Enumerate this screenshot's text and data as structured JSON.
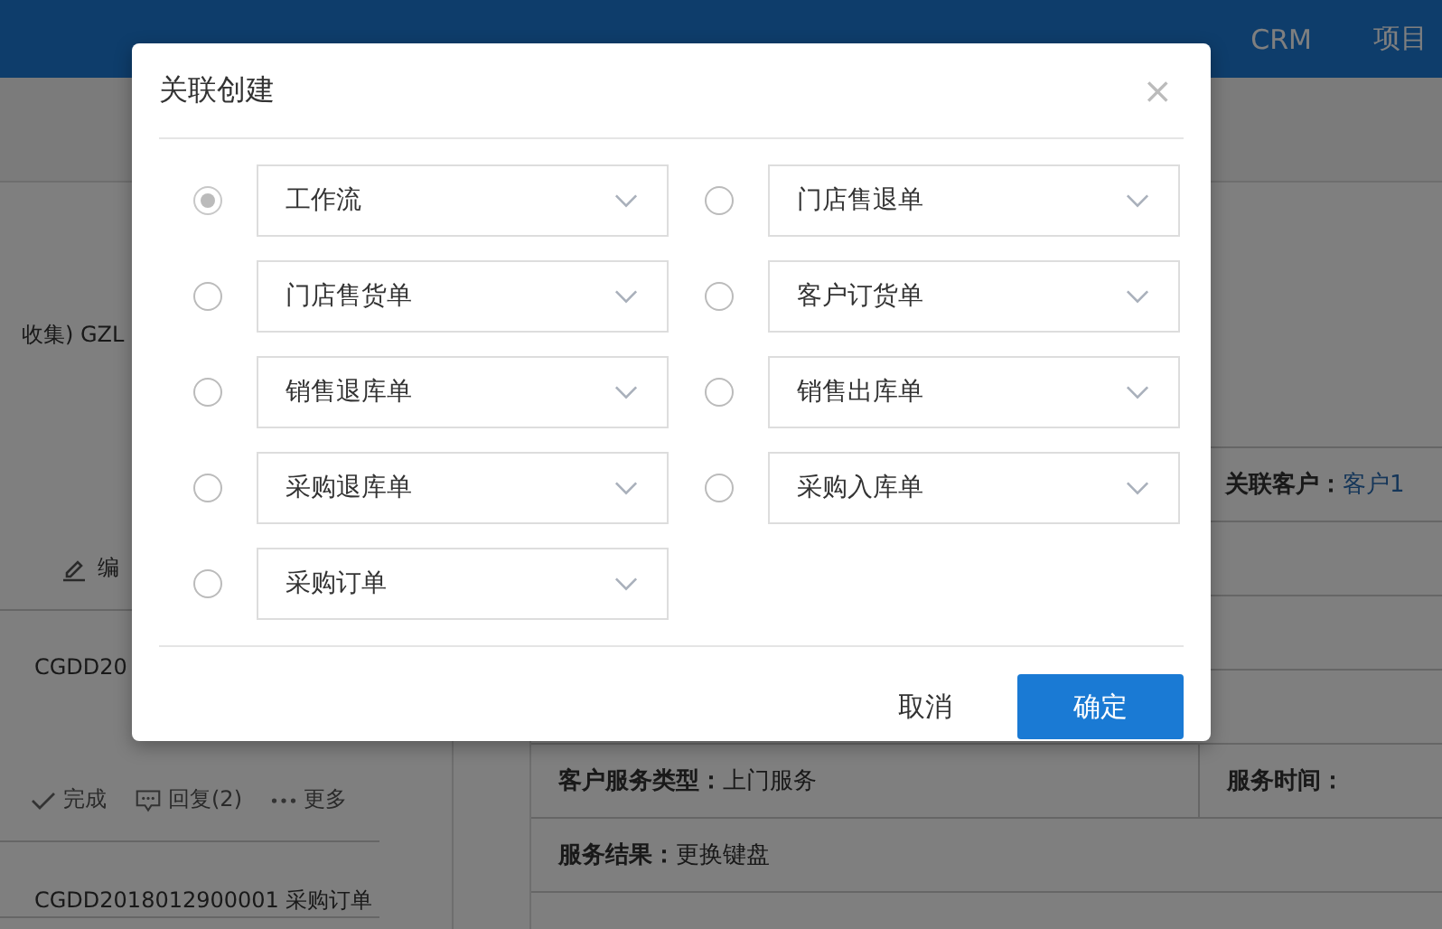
{
  "nav": [
    "CRM",
    "项目"
  ],
  "left_panel": {
    "header_text": "收集)  GZL",
    "actions_top": [
      {
        "kind": "edit",
        "label": "编"
      }
    ],
    "cards": [
      {
        "title": "CGDD20",
        "actions": [
          {
            "kind": "check",
            "label": "完成"
          },
          {
            "kind": "reply",
            "label": "回复(2)"
          },
          {
            "kind": "more",
            "label": "更多"
          }
        ]
      },
      {
        "title": "CGDD2018012900001 采购订单"
      }
    ]
  },
  "detail_rows": [
    {
      "kind": "field",
      "side_label": "关联客户：",
      "side_value": "客户1"
    },
    {
      "kind": "empty"
    },
    {
      "kind": "empty"
    },
    {
      "kind": "empty"
    },
    {
      "kind": "field",
      "label": "客户服务类型：",
      "value": "上门服务",
      "side_label": "服务时间："
    },
    {
      "kind": "field",
      "label": "服务结果：",
      "value": "更换键盘"
    },
    {
      "kind": "empty"
    }
  ],
  "dialog": {
    "title": "关联创建",
    "close": "×",
    "options": [
      {
        "label": "工作流",
        "selected": true
      },
      {
        "label": "门店售退单",
        "selected": false
      },
      {
        "label": "门店售货单",
        "selected": false
      },
      {
        "label": "客户订货单",
        "selected": false
      },
      {
        "label": "销售退库单",
        "selected": false
      },
      {
        "label": "销售出库单",
        "selected": false
      },
      {
        "label": "采购退库单",
        "selected": false
      },
      {
        "label": "采购入库单",
        "selected": false
      },
      {
        "label": "采购订单",
        "selected": false
      }
    ],
    "cancel": "取消",
    "confirm": "确定"
  }
}
